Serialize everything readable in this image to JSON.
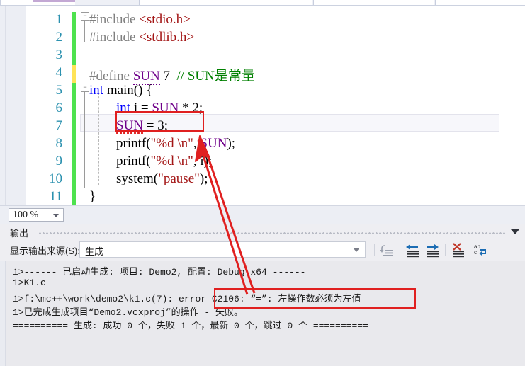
{
  "window": {
    "app": "visual-studio",
    "tabstrip_visible_sliver": true
  },
  "editor": {
    "zoom_level": "100 %",
    "lines": [
      {
        "num": "1",
        "change": "green",
        "indent": 0,
        "tokens": [
          {
            "t": "#include ",
            "c": "pre"
          },
          {
            "t": "<stdio.h>",
            "c": "str"
          }
        ]
      },
      {
        "num": "2",
        "change": "green",
        "indent": 0,
        "tokens": [
          {
            "t": "#include ",
            "c": "pre"
          },
          {
            "t": "<stdlib.h>",
            "c": "str"
          }
        ]
      },
      {
        "num": "3",
        "change": "green",
        "indent": 0,
        "tokens": []
      },
      {
        "num": "4",
        "change": "yellow",
        "indent": 0,
        "tokens": [
          {
            "t": "#define ",
            "c": "pre"
          },
          {
            "t": "SUN",
            "c": "macro-squiggle"
          },
          {
            "t": " 7  ",
            "c": "plain"
          },
          {
            "t": "// SUN是常量",
            "c": "cmt"
          }
        ]
      },
      {
        "num": "5",
        "change": "green",
        "indent": 0,
        "tokens": [
          {
            "t": "int",
            "c": "kw"
          },
          {
            "t": " main() {",
            "c": "plain"
          }
        ]
      },
      {
        "num": "6",
        "change": "green",
        "indent": 1,
        "tokens": [
          {
            "t": "int",
            "c": "kw"
          },
          {
            "t": " i = ",
            "c": "plain"
          },
          {
            "t": "SUN",
            "c": "macro"
          },
          {
            "t": " * 2;",
            "c": "plain"
          }
        ]
      },
      {
        "num": "7",
        "change": "green",
        "indent": 1,
        "tokens": [
          {
            "t": "SUN",
            "c": "macro-err"
          },
          {
            "t": " = 3;",
            "c": "plain"
          }
        ]
      },
      {
        "num": "8",
        "change": "green",
        "indent": 1,
        "tokens": [
          {
            "t": "printf(",
            "c": "plain"
          },
          {
            "t": "\"%d \\n\"",
            "c": "str"
          },
          {
            "t": ", ",
            "c": "plain"
          },
          {
            "t": "SUN",
            "c": "macro"
          },
          {
            "t": ");",
            "c": "plain"
          }
        ]
      },
      {
        "num": "9",
        "change": "green",
        "indent": 1,
        "tokens": [
          {
            "t": "printf(",
            "c": "plain"
          },
          {
            "t": "\"%d \\n\"",
            "c": "str"
          },
          {
            "t": ", i);",
            "c": "plain"
          }
        ]
      },
      {
        "num": "10",
        "change": "green",
        "indent": 1,
        "tokens": [
          {
            "t": "system(",
            "c": "plain"
          },
          {
            "t": "\"pause\"",
            "c": "str"
          },
          {
            "t": ");",
            "c": "plain"
          }
        ]
      },
      {
        "num": "11",
        "change": "green",
        "indent": 0,
        "tokens": [
          {
            "t": "}",
            "c": "plain"
          }
        ]
      }
    ]
  },
  "output": {
    "title": "输出",
    "source_label": "显示输出来源(S):",
    "source_value": "生成",
    "toolbar_icons": [
      "jump-to-source-icon",
      "navigate-backward-icon",
      "navigate-forward-icon",
      "clear-all-icon",
      "toggle-word-wrap-icon"
    ],
    "lines": [
      "1>------ 已启动生成: 项目: Demo2, 配置: Debug x64 ------",
      "1>K1.c",
      "1>f:\\mc++\\work\\demo2\\k1.c(7): error C2106: “=”: 左操作数必须为左值",
      "1>已完成生成项目“Demo2.vcxproj”的操作 - 失败。",
      "========== 生成: 成功 0 个，失败 1 个，最新 0 个，跳过 0 个 =========="
    ]
  },
  "annotations": {
    "accent_color": "#e02020",
    "code_highlight_box": "SUN = 3;",
    "error_highlight_box": "C2106: “=”: 左操作数必须为左值",
    "arrow": "points from error message up to printf line"
  },
  "colors": {
    "preprocessor": "#808080",
    "string": "#a31515",
    "keyword": "#0000ff",
    "macro": "#6f008a",
    "comment": "#008000",
    "line_number": "#2b91af",
    "change_bar_saved": "#4ee24e",
    "change_bar_unsaved": "#ffe357",
    "annotation_red": "#e02020"
  }
}
